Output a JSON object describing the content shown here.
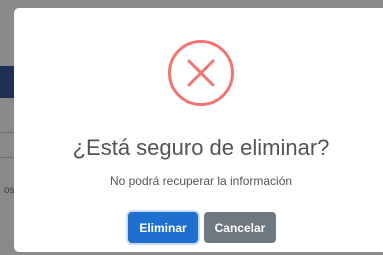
{
  "background": {
    "partial_text": "os",
    "colors": {
      "overlay": "#8a8a8a",
      "header": "#1f2f55"
    }
  },
  "dialog": {
    "icon": "error-x-icon",
    "icon_color": "#f27474",
    "title": "¿Está seguro de eliminar?",
    "message": "No podrá recuperar la información",
    "confirm_label": "Eliminar",
    "cancel_label": "Cancelar",
    "confirm_color": "#1e6fd0",
    "cancel_color": "#6e7881"
  }
}
